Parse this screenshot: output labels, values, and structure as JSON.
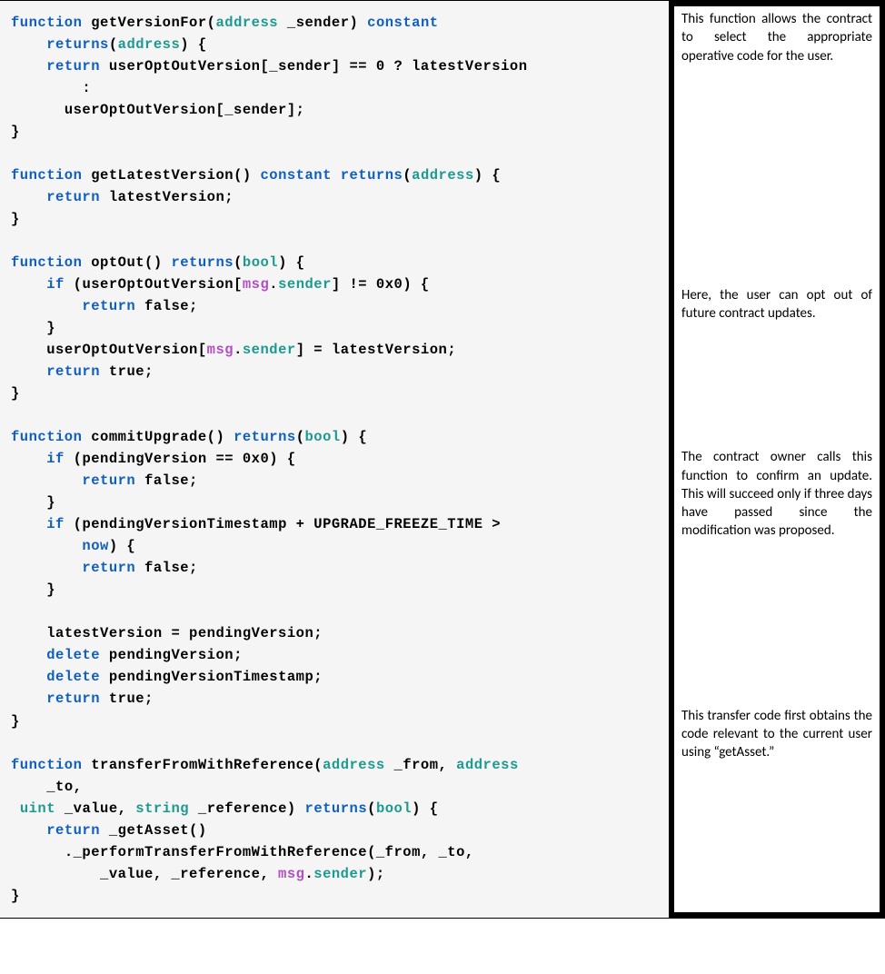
{
  "syntax": {
    "kw_function": "function",
    "kw_returns": "returns",
    "kw_return": "return",
    "kw_constant": "constant",
    "kw_if": "if",
    "kw_delete": "delete",
    "kw_now": "now",
    "type_address": "address",
    "type_bool": "bool",
    "type_uint": "uint",
    "type_string": "string",
    "msg": "msg",
    "sender": "sender"
  },
  "code": {
    "fn1_name": "getVersionFor",
    "fn1_param": "_sender",
    "fn1_body_a": "userOptOutVersion[_sender] == 0 ? latestVersion",
    "fn1_body_colon": ":",
    "fn1_body_b": "userOptOutVersion[_sender];",
    "fn2_name": "getLatestVersion",
    "fn2_body": "latestVersion;",
    "fn3_name": "optOut",
    "fn3_if_a": "(userOptOutVersion[",
    "fn3_if_b": "] != 0x0) {",
    "fn3_ret_false": "false;",
    "fn3_assign_a": "userOptOutVersion[",
    "fn3_assign_b": "] = latestVersion;",
    "fn3_ret_true": "true;",
    "fn4_name": "commitUpgrade",
    "fn4_if1": "(pendingVersion == 0x0) {",
    "fn4_if2a": "(pendingVersionTimestamp + UPGRADE_FREEZE_TIME >",
    "fn4_if2b": ") {",
    "fn4_assign": "latestVersion = pendingVersion;",
    "fn4_del1": "pendingVersion;",
    "fn4_del2": "pendingVersionTimestamp;",
    "fn5_name": "transferFromWithReference",
    "fn5_p_from": "_from",
    "fn5_p_to": "_to",
    "fn5_p_value": "_value",
    "fn5_p_ref": "_reference",
    "fn5_body_a": "_getAsset()",
    "fn5_body_b": "._performTransferFromWithReference(_from, _to,",
    "fn5_body_c": "_value, _reference, ",
    "fn5_body_d": ");"
  },
  "annotations": {
    "a1": "This function allows the contract to select the appropriate operative code for the user.",
    "a2": "Here, the user can opt out of future contract updates.",
    "a3": "The contract owner calls this function to confirm an update. This will succeed only if three days have passed since the modification was proposed.",
    "a4": "This transfer code first obtains the code relevant to the current user using “getAsset.”"
  }
}
